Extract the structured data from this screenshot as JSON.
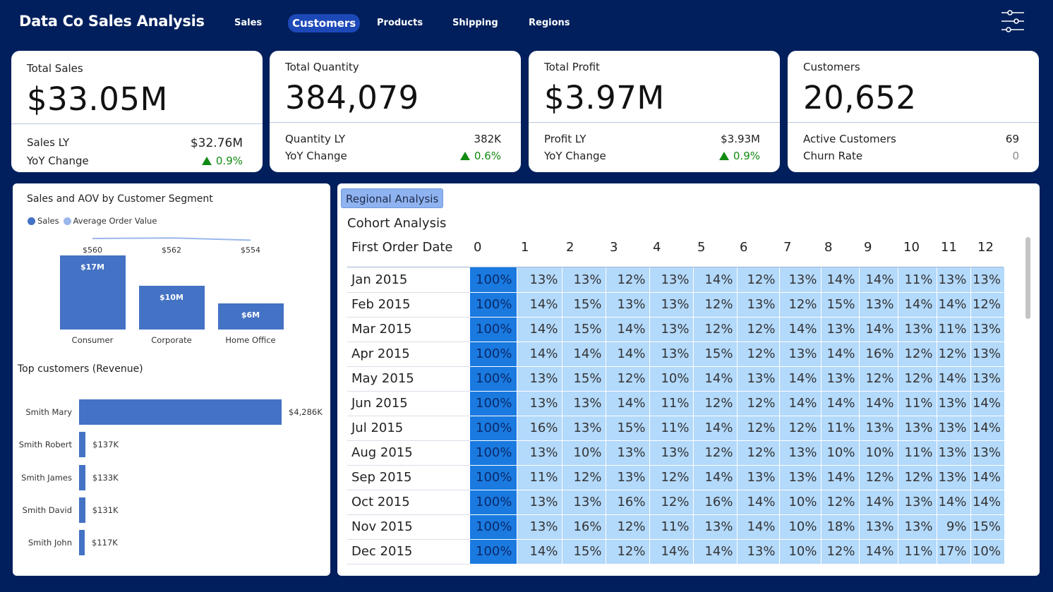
{
  "app": {
    "title": "Data Co Sales Analysis"
  },
  "nav": {
    "tabs": [
      {
        "label": "Sales",
        "active": false
      },
      {
        "label": "Customers",
        "active": true
      },
      {
        "label": "Products",
        "active": false
      },
      {
        "label": "Shipping",
        "active": false
      },
      {
        "label": "Regions",
        "active": false
      }
    ],
    "filter_icon": "sliders-icon"
  },
  "kpis": [
    {
      "title": "Total Sales",
      "value": "$33.05M",
      "row1_label": "Sales LY",
      "row1_value": "$32.76M",
      "row2_label": "YoY Change",
      "row2_value": "0.9%"
    },
    {
      "title": "Total Quantity",
      "value": "384,079",
      "row1_label": "Quantity LY",
      "row1_value": "382K",
      "row2_label": "YoY Change",
      "row2_value": "0.6%"
    },
    {
      "title": "Total Profit",
      "value": "$3.97M",
      "row1_label": "Profit LY",
      "row1_value": "$3.93M",
      "row2_label": "YoY Change",
      "row2_value": "0.9%"
    },
    {
      "title": "Customers",
      "value": "20,652",
      "row1_label": "Active Customers",
      "row1_value": "69",
      "row2_label": "Churn Rate",
      "row2_value": "0"
    }
  ],
  "colors": {
    "background": "#001f5c",
    "accent": "#4472c4",
    "positive": "#128a12",
    "cohort_first": "#1a7ae0",
    "cohort_cell": "#b3d9fb"
  },
  "segment_chart": {
    "title": "Sales and AOV by Customer Segment",
    "legend": [
      "Sales",
      "Average Order Value"
    ]
  },
  "top_customers": {
    "title": "Top customers (Revenue)"
  },
  "chart_data": [
    {
      "type": "bar",
      "title": "Sales and AOV by Customer Segment",
      "categories": [
        "Consumer",
        "Corporate",
        "Home Office"
      ],
      "series": [
        {
          "name": "Sales",
          "values": [
            17,
            10,
            6
          ],
          "labels": [
            "$17M",
            "$10M",
            "$6M"
          ]
        },
        {
          "name": "Average Order Value",
          "values": [
            560,
            562,
            554
          ],
          "labels": [
            "$560",
            "$562",
            "$554"
          ]
        }
      ]
    },
    {
      "type": "bar",
      "title": "Top customers (Revenue)",
      "orientation": "horizontal",
      "categories": [
        "Smith Mary",
        "Smith Robert",
        "Smith James",
        "Smith David",
        "Smith John"
      ],
      "values": [
        4286,
        137,
        133,
        131,
        117
      ],
      "labels": [
        "$4,286K",
        "$137K",
        "$133K",
        "$131K",
        "$117K"
      ]
    }
  ],
  "regional": {
    "button_label": "Regional Analysis"
  },
  "cohort": {
    "title": "Cohort Analysis",
    "date_header": "First Order Date",
    "columns": [
      "0",
      "1",
      "2",
      "3",
      "4",
      "5",
      "6",
      "7",
      "8",
      "9",
      "10",
      "11",
      "12"
    ],
    "rows": [
      {
        "date": "Jan 2015",
        "values": [
          "100%",
          "13%",
          "13%",
          "12%",
          "13%",
          "14%",
          "12%",
          "13%",
          "14%",
          "14%",
          "11%",
          "13%",
          "13%"
        ]
      },
      {
        "date": "Feb 2015",
        "values": [
          "100%",
          "14%",
          "15%",
          "13%",
          "13%",
          "12%",
          "13%",
          "12%",
          "15%",
          "13%",
          "14%",
          "14%",
          "12%"
        ]
      },
      {
        "date": "Mar 2015",
        "values": [
          "100%",
          "14%",
          "15%",
          "14%",
          "13%",
          "12%",
          "12%",
          "14%",
          "13%",
          "14%",
          "13%",
          "11%",
          "13%"
        ]
      },
      {
        "date": "Apr 2015",
        "values": [
          "100%",
          "14%",
          "14%",
          "14%",
          "13%",
          "15%",
          "12%",
          "13%",
          "14%",
          "16%",
          "12%",
          "12%",
          "13%"
        ]
      },
      {
        "date": "May 2015",
        "values": [
          "100%",
          "13%",
          "15%",
          "12%",
          "10%",
          "14%",
          "13%",
          "14%",
          "13%",
          "12%",
          "12%",
          "14%",
          "13%"
        ]
      },
      {
        "date": "Jun 2015",
        "values": [
          "100%",
          "13%",
          "13%",
          "14%",
          "11%",
          "12%",
          "12%",
          "14%",
          "14%",
          "14%",
          "11%",
          "13%",
          "14%"
        ]
      },
      {
        "date": "Jul 2015",
        "values": [
          "100%",
          "16%",
          "13%",
          "15%",
          "11%",
          "14%",
          "12%",
          "12%",
          "11%",
          "13%",
          "13%",
          "13%",
          "14%"
        ]
      },
      {
        "date": "Aug 2015",
        "values": [
          "100%",
          "13%",
          "10%",
          "13%",
          "13%",
          "12%",
          "12%",
          "13%",
          "10%",
          "10%",
          "11%",
          "13%",
          "13%"
        ]
      },
      {
        "date": "Sep 2015",
        "values": [
          "100%",
          "11%",
          "12%",
          "13%",
          "12%",
          "14%",
          "13%",
          "13%",
          "14%",
          "12%",
          "12%",
          "13%",
          "14%"
        ]
      },
      {
        "date": "Oct 2015",
        "values": [
          "100%",
          "13%",
          "13%",
          "16%",
          "12%",
          "16%",
          "14%",
          "10%",
          "12%",
          "14%",
          "13%",
          "14%",
          "14%"
        ]
      },
      {
        "date": "Nov 2015",
        "values": [
          "100%",
          "13%",
          "16%",
          "12%",
          "11%",
          "13%",
          "14%",
          "10%",
          "18%",
          "13%",
          "13%",
          "9%",
          "15%"
        ]
      },
      {
        "date": "Dec 2015",
        "values": [
          "100%",
          "14%",
          "15%",
          "12%",
          "14%",
          "14%",
          "13%",
          "10%",
          "12%",
          "14%",
          "11%",
          "17%",
          "10%"
        ]
      }
    ]
  }
}
